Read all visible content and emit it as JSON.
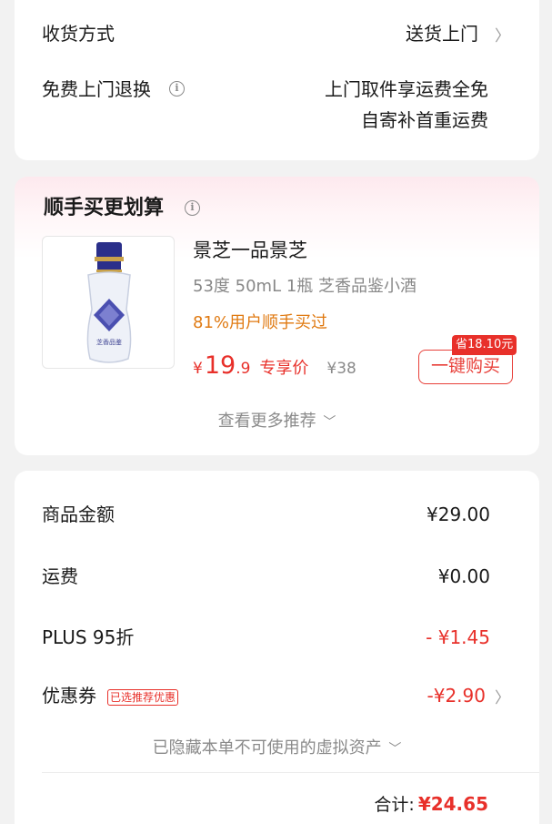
{
  "delivery": {
    "method_label": "收货方式",
    "method_value": "送货上门",
    "return_label": "免费上门退换",
    "return_value_line1": "上门取件享运费全免",
    "return_value_line2": "自寄补首重运费"
  },
  "addon": {
    "title": "顺手买更划算",
    "product": {
      "name": "景芝一品景芝",
      "spec": "53度 50mL 1瓶 芝香品鉴小酒",
      "social_proof": "81%用户顺手买过",
      "currency": "¥",
      "price_int": "19",
      "price_dec": ".9",
      "price_label": "专享价",
      "original_price": "¥38",
      "save_badge": "省18.10元",
      "buy_button": "一键购买",
      "bottle_label": "芝香品鉴"
    },
    "more": "查看更多推荐"
  },
  "summary": {
    "rows": [
      {
        "label": "商品金额",
        "value": "¥29.00"
      },
      {
        "label": "运费",
        "value": "¥0.00"
      },
      {
        "label": "PLUS 95折",
        "value": "- ¥1.45"
      },
      {
        "label": "优惠券",
        "tag": "已选推荐优惠",
        "value": "-¥2.90"
      }
    ],
    "hidden_assets": "已隐藏本单不可使用的虚拟资产",
    "total_label": "合计:",
    "total_value": "¥24.65"
  },
  "colors": {
    "accent_red": "#e8302a",
    "social_orange": "#e07a12",
    "background": "#f2f2f2"
  },
  "icons": [
    "info-icon",
    "chevron-right-icon",
    "chevron-down-icon"
  ]
}
